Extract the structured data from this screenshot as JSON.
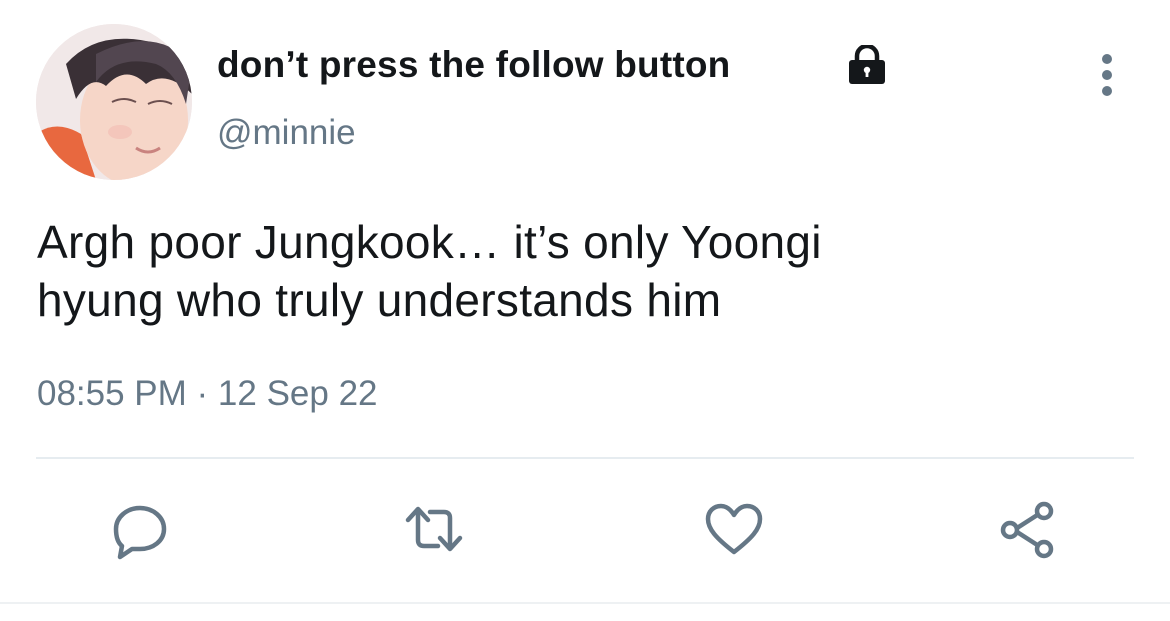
{
  "tweet": {
    "display_name": "don’t press the follow button",
    "handle": "@minnie",
    "text_lines": [
      "Argh poor Jungkook… it’s only Yoongi",
      "hyung who truly understands him"
    ],
    "timestamp": "08:55 PM · 12 Sep 22",
    "protected": true
  },
  "icons": {
    "lock": "lock-icon",
    "more": "more-vertical-icon",
    "reply": "reply-icon",
    "retweet": "retweet-icon",
    "like": "heart-icon",
    "share": "share-icon"
  },
  "colors": {
    "text_primary": "#14171a",
    "text_secondary": "#657786",
    "icon_gray": "#657786",
    "divider": "#e6ecf0"
  }
}
